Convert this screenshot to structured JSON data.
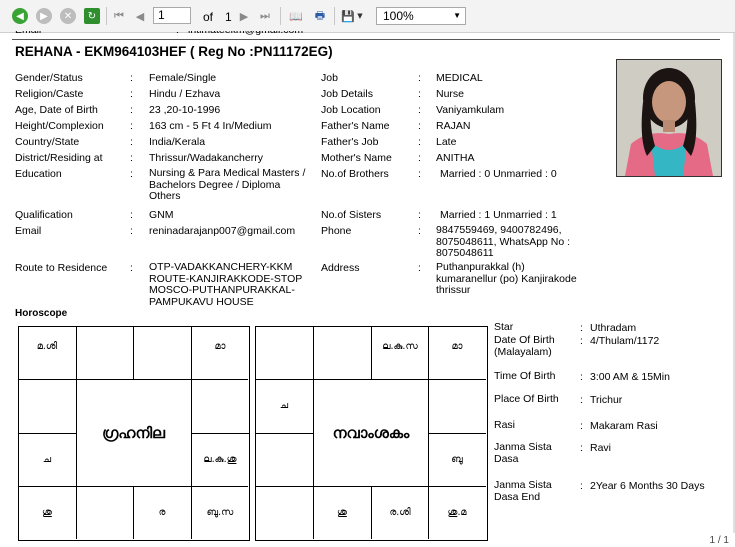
{
  "toolbar": {
    "current_page": "1",
    "of_label": "of",
    "total_pages": "1",
    "zoom": "100%"
  },
  "header_cut": {
    "label": "Email",
    "colon": ":",
    "value": "intimateekm@gmail.com"
  },
  "title": "REHANA - EKM964103HEF ( Reg No :PN11172EG)",
  "left_fields": [
    {
      "label": "Gender/Status",
      "value": "Female/Single"
    },
    {
      "label": "Religion/Caste",
      "value": "Hindu / Ezhava"
    },
    {
      "label": "Age, Date of Birth",
      "value": "23 ,20-10-1996"
    },
    {
      "label": "Height/Complexion",
      "value": "163 cm - 5 Ft 4 In/Medium"
    },
    {
      "label": "Country/State",
      "value": "India/Kerala"
    },
    {
      "label": "District/Residing at",
      "value": "Thrissur/Wadakancherry"
    },
    {
      "label": "Education",
      "value": "Nursing & Para Medical Masters / Bachelors Degree / Diploma Others"
    },
    {
      "label": "Qualification",
      "value": "GNM"
    },
    {
      "label": "Email",
      "value": "reninadarajanp007@gmail.com"
    },
    {
      "label": "Route to Residence",
      "value": "OTP-VADAKKANCHERY-KKM ROUTE-KANJIRAKKODE-STOP MOSCO-PUTHANPURAKKAL-PAMPUKAVU HOUSE"
    }
  ],
  "right_fields": [
    {
      "label": "Job",
      "value": "MEDICAL"
    },
    {
      "label": "Job Details",
      "value": "Nurse"
    },
    {
      "label": "Job Location",
      "value": "Vaniyamkulam"
    },
    {
      "label": "Father's Name",
      "value": "RAJAN"
    },
    {
      "label": "Father's Job",
      "value": "Late"
    },
    {
      "label": "Mother's Name",
      "value": "ANITHA"
    },
    {
      "label": "No.of Brothers",
      "value": "Married : 0   Unmarried : 0"
    },
    {
      "label": "No.of Sisters",
      "value": "Married : 1   Unmarried : 1"
    },
    {
      "label": "Phone",
      "value": "9847559469, 9400782496, 8075048611, WhatsApp No : 8075048611"
    },
    {
      "label": "Address",
      "value": "Puthanpurakkal (h) kumaranellur (po) Kanjirakode thrissur"
    }
  ],
  "colon": ":",
  "horoscope_label": "Horoscope",
  "grahanila": {
    "title": "ഗ്രഹനില",
    "c0_0": "മ.ശി",
    "c0_3": "മാ",
    "c2_0": "ച",
    "c2_3": "ല.കു.ശു",
    "c3_0": "ശു",
    "c3_2": "ര",
    "c3_3": "ബു.സ"
  },
  "navamsakam": {
    "title": "നവാംശകം",
    "c0_2": "ല.കു.സ",
    "c0_3": "മാ",
    "c1_0": "ച",
    "c2_3": "ബു",
    "c3_1": "ശു",
    "c3_2": "ര.ശി",
    "c3_3": "ശു.മ"
  },
  "star_info": [
    {
      "label": "Star",
      "value": "Uthradam"
    },
    {
      "label": "Date Of Birth (Malayalam)",
      "value": "4/Thulam/1172"
    },
    {
      "label": "Time Of Birth",
      "value": "3:00 AM & 15Min"
    },
    {
      "label": "Place Of Birth",
      "value": "Trichur"
    },
    {
      "label": "Rasi",
      "value": "Makaram Rasi"
    },
    {
      "label": "Janma Sista Dasa",
      "value": "Ravi"
    },
    {
      "label": "Janma Sista Dasa End",
      "value": "2Year  6 Months 30 Days"
    }
  ],
  "footer": "1 / 1"
}
